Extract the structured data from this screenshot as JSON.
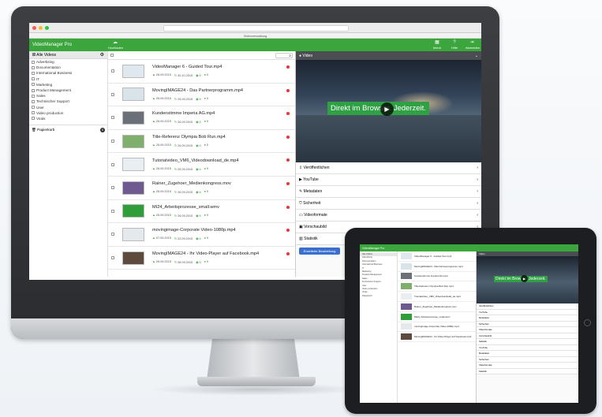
{
  "browser": {
    "url": "                                                                                                            ",
    "tab_title": "Videoverwaltung"
  },
  "app": {
    "brand": "VideoManager Pro",
    "upload_label": "Hochladen",
    "menu_label": "Menü",
    "help_label": "Hilfe",
    "logout_label": "Abmelden",
    "colors": {
      "primary": "#3aa63c",
      "accent_blue": "#3a6fd0",
      "status_red": "#e33333"
    }
  },
  "sidebar": {
    "header": "Alle Videos",
    "items": [
      "Advertising",
      "Documentation",
      "International Business",
      "IT",
      "Marketing",
      "Product Management",
      "Sales",
      "Technischer Support",
      "User",
      "Video production",
      "Virals"
    ],
    "trash": "Papierkorb",
    "trash_count": "0"
  },
  "videos": [
    {
      "title": "VideoManager 6 - Guided Tour.mp4",
      "date1": "26.09.2015",
      "date2": "30.10.2015",
      "views": "0",
      "likes": "0"
    },
    {
      "title": "MovingIMAGE24 - Das Partnerprogramm.mp4",
      "date1": "26.09.2015",
      "date2": "25.09.2015",
      "views": "0",
      "likes": "0"
    },
    {
      "title": "Kundenstimme Imperia AG.mp4",
      "date1": "26.09.2015",
      "date2": "26.09.2015",
      "views": "0",
      "likes": "0"
    },
    {
      "title": "Title-Referenz Olympia Bob Run.mp4",
      "date1": "26.09.2015",
      "date2": "26.09.2015",
      "views": "0",
      "likes": "0"
    },
    {
      "title": "Tutorialvideo_VM6_Videodownload_de.mp4",
      "date1": "26.09.2015",
      "date2": "25.09.2015",
      "views": "0",
      "likes": "0"
    },
    {
      "title": "Rainer_Zugehoer_Medienkongress.mov",
      "date1": "26.09.2015",
      "date2": "26.09.2015",
      "views": "0",
      "likes": "0"
    },
    {
      "title": "MI24_Arbeitsprozesse_small.wmv",
      "date1": "26.09.2015",
      "date2": "26.09.2015",
      "views": "0",
      "likes": "0"
    },
    {
      "title": "movingimage-Corporate Video-1080p.mp4",
      "date1": "07.09.2015",
      "date2": "22.09.2015",
      "views": "0",
      "likes": "0"
    },
    {
      "title": "MovingIMAGE24 - Ihr Video-Player auf Facebook.mp4",
      "date1": "26.09.2015",
      "date2": "08.09.2015",
      "views": "0",
      "likes": "0"
    }
  ],
  "detail": {
    "header": "Video",
    "banner_text": "Direkt im Browser. Jederzeit.",
    "sections": [
      "Veröffentlichen",
      "YouTube",
      "Metadaten",
      "Sicherheit",
      "Videoformate",
      "Vorschaubild",
      "Statistik"
    ],
    "advanced_button": "Erweiterte Bearbeitung"
  },
  "ipad": {
    "sections": [
      "Veröffentlichen",
      "YouTube",
      "Metadaten",
      "Sicherheit",
      "Videoformate",
      "Vorschaubild",
      "Statistik",
      "YouTube",
      "Metadaten",
      "Sicherheit",
      "Videoformate",
      "Statistik"
    ]
  }
}
